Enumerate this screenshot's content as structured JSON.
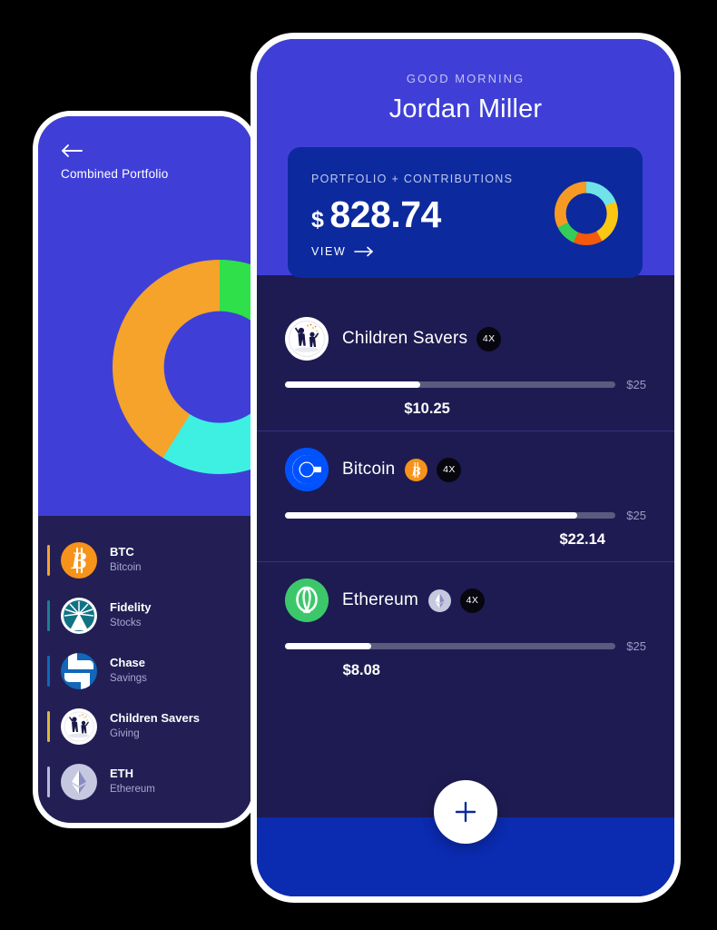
{
  "colors": {
    "purple_header": "#3f3fd8",
    "dark_navy": "#1e1b52",
    "card_blue": "#0c2a9e",
    "bottom_bar_blue": "#0b2bb0",
    "bitcoin_orange": "#f7931a",
    "coinbase_blue": "#0052ff",
    "ethereum_green": "#3cc86a",
    "eth_grey": "#c6c8e0",
    "badge_black": "#07060e",
    "bar_fill": "#ffffff",
    "bar_track": "#5a5b7f"
  },
  "back_phone": {
    "back_icon": "arrow-left-icon",
    "title": "Combined Portfolio",
    "donut": {
      "type": "pie",
      "title": "Combined Portfolio",
      "segments": [
        {
          "label": "Bitcoin",
          "color": "#f5a32a",
          "percent": 40
        },
        {
          "label": "Children Savers",
          "color": "#2fe04a",
          "percent": 12
        },
        {
          "label": "Fidelity",
          "color": "#2fe04a",
          "percent": 3
        },
        {
          "label": "Chase",
          "color": "#3ef0e2",
          "percent": 45
        }
      ]
    },
    "legend": [
      {
        "name": "BTC",
        "sub": "Bitcoin",
        "accent": "#f5a32a",
        "logo": "bitcoin-icon"
      },
      {
        "name": "Fidelity",
        "sub": "Stocks",
        "accent": "#1c7f93",
        "logo": "fidelity-icon"
      },
      {
        "name": "Chase",
        "sub": "Savings",
        "accent": "#1167b8",
        "logo": "chase-icon"
      },
      {
        "name": "Children Savers",
        "sub": "Giving",
        "accent": "#d9b93c",
        "logo": "children-savers-icon"
      },
      {
        "name": "ETH",
        "sub": "Ethereum",
        "accent": "#b9bada",
        "logo": "ethereum-icon"
      }
    ]
  },
  "front_phone": {
    "greeting": "GOOD MORNING",
    "user_name": "Jordan Miller",
    "card": {
      "label": "PORTFOLIO + CONTRIBUTIONS",
      "currency": "$",
      "amount": "828.74",
      "view_label": "VIEW",
      "view_arrow_icon": "arrow-right-icon",
      "donut": {
        "type": "pie",
        "segments": [
          {
            "label": "cyan",
            "color": "#6fe3e8",
            "percent": 19
          },
          {
            "label": "gold",
            "color": "#fac715",
            "percent": 23
          },
          {
            "label": "orange-red",
            "color": "#f4590c",
            "percent": 15
          },
          {
            "label": "green",
            "color": "#35cc5a",
            "percent": 11
          },
          {
            "label": "orange",
            "color": "#f79a24",
            "percent": 32
          }
        ]
      }
    },
    "assets": [
      {
        "name": "Children Savers",
        "logo": "children-savers-icon",
        "coin_badge": null,
        "multiplier": "4X",
        "value_label": "$10.25",
        "max_label": "$25",
        "progress_percent": 41
      },
      {
        "name": "Bitcoin",
        "logo": "coinbase-icon",
        "coin_badge": "bitcoin-icon",
        "multiplier": "4X",
        "value_label": "$22.14",
        "max_label": "$25",
        "progress_percent": 88.5
      },
      {
        "name": "Ethereum",
        "logo": "okx-green-icon",
        "coin_badge": "ethereum-icon",
        "multiplier": "4X",
        "value_label": "$8.08",
        "max_label": "$25",
        "progress_percent": 26
      }
    ],
    "fab_icon": "plus-icon"
  }
}
